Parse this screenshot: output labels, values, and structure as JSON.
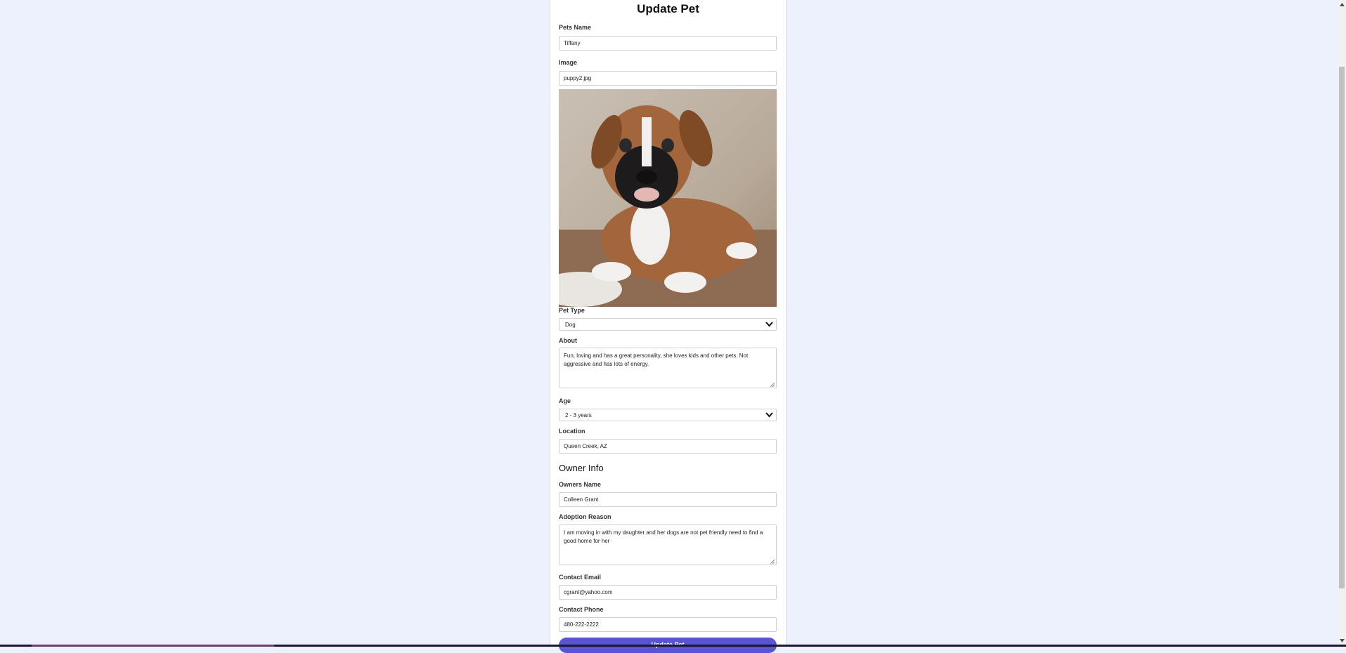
{
  "page": {
    "title": "Update Pet"
  },
  "form": {
    "pets_name": {
      "label": "Pets Name",
      "value": "Tiffany"
    },
    "image": {
      "label": "Image",
      "value": "puppy2.jpg"
    },
    "pet_type": {
      "label": "Pet Type",
      "value": "Dog"
    },
    "about": {
      "label": "About",
      "value": "Fun, loving and has a great personality, she loves kids and other pets. Not aggressive and has lots of energy."
    },
    "age": {
      "label": "Age",
      "value": "2 - 3 years"
    },
    "location": {
      "label": "Location",
      "value": "Queen Creek, AZ"
    }
  },
  "owner": {
    "heading": "Owner Info",
    "owners_name": {
      "label": "Owners Name",
      "value": "Colleen Grant"
    },
    "adoption_reason": {
      "label": "Adoption Reason",
      "value": "I am moving in with my daughter and her dogs are not pet friendly need to find a good home for her"
    },
    "contact_email": {
      "label": "Contact Email",
      "value": "cgrant@yahoo.com"
    },
    "contact_phone": {
      "label": "Contact Phone",
      "value": "480-222-2222"
    }
  },
  "submit_label": "Update Pet",
  "colors": {
    "background": "#edf1fd",
    "accent": "#5b53d6"
  }
}
